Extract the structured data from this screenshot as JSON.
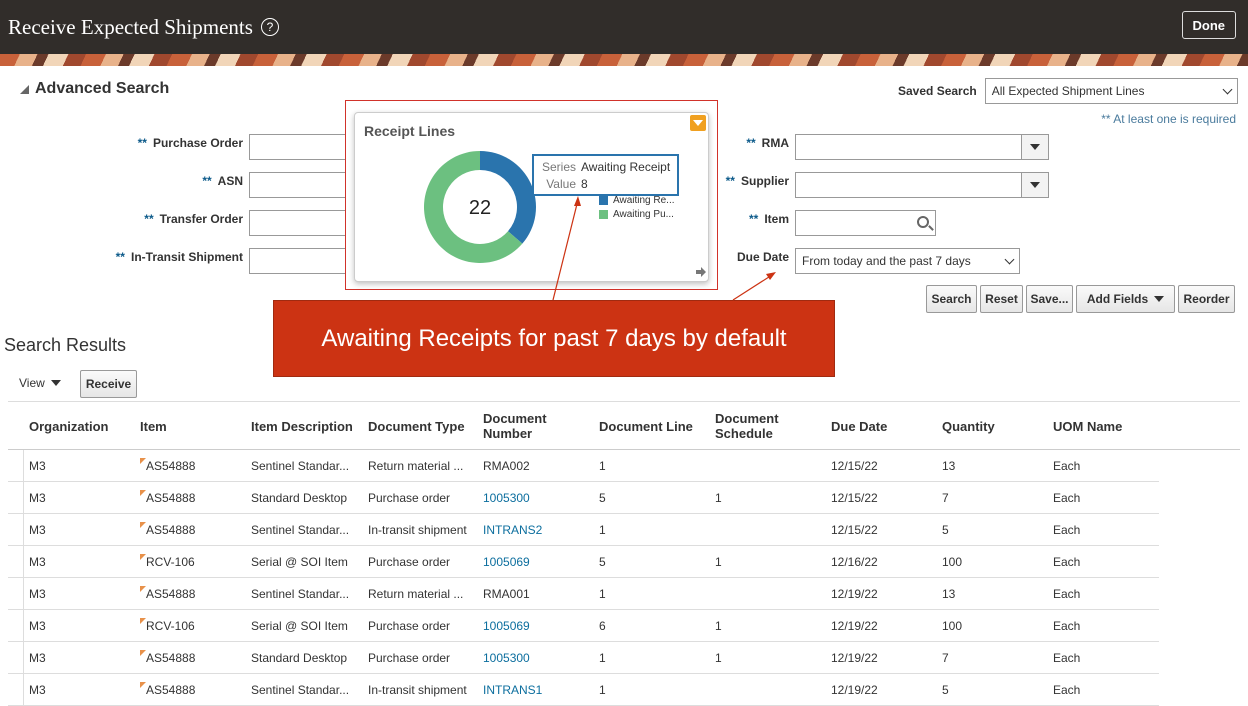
{
  "header": {
    "title": "Receive Expected Shipments",
    "help_glyph": "?",
    "done_label": "Done"
  },
  "search": {
    "advanced_label": "Advanced Search",
    "saved_search_label": "Saved Search",
    "saved_search_value": "All Expected Shipment Lines",
    "required_note": "** At least one is required",
    "required_marker": "**",
    "fields": {
      "purchase_order": "Purchase Order",
      "asn": "ASN",
      "transfer_order": "Transfer Order",
      "in_transit_shipment": "In-Transit Shipment",
      "rma": "RMA",
      "supplier": "Supplier",
      "item": "Item",
      "due_date": "Due Date"
    },
    "due_date_value": "From today and the past 7 days",
    "buttons": {
      "search": "Search",
      "reset": "Reset",
      "save": "Save...",
      "add_fields": "Add Fields",
      "reorder": "Reorder"
    }
  },
  "popup": {
    "title": "Receipt Lines",
    "total": "22",
    "legend": [
      "Awaiting Re...",
      "Awaiting Pu..."
    ],
    "tooltip": {
      "series_key": "Series",
      "series_value": "Awaiting Receipt",
      "value_key": "Value",
      "value_value": "8"
    },
    "colors": {
      "awaiting_receipt": "#2a74ad",
      "awaiting_putaway": "#6cc080"
    },
    "segments": [
      {
        "name": "Awaiting Receipt",
        "value": 8
      },
      {
        "name": "Awaiting Putaway",
        "value": 14
      }
    ]
  },
  "callout": {
    "text": "Awaiting Receipts for past 7 days by default"
  },
  "results": {
    "title": "Search Results",
    "view_label": "View",
    "receive_label": "Receive",
    "columns": [
      "Organization",
      "Item",
      "Item Description",
      "Document Type",
      "Document Number",
      "Document Line",
      "Document Schedule",
      "Due Date",
      "Quantity",
      "UOM Name"
    ],
    "rows": [
      [
        "M3",
        "AS54888",
        "Sentinel Standar...",
        "Return material ...",
        "RMA002",
        "1",
        "",
        "12/15/22",
        "13",
        "Each"
      ],
      [
        "M3",
        "AS54888",
        "Standard Desktop",
        "Purchase order",
        "1005300",
        "5",
        "1",
        "12/15/22",
        "7",
        "Each"
      ],
      [
        "M3",
        "AS54888",
        "Sentinel Standar...",
        "In-transit shipment",
        "INTRANS2",
        "1",
        "",
        "12/15/22",
        "5",
        "Each"
      ],
      [
        "M3",
        "RCV-106",
        "Serial @ SOI Item",
        "Purchase order",
        "1005069",
        "5",
        "1",
        "12/16/22",
        "100",
        "Each"
      ],
      [
        "M3",
        "AS54888",
        "Sentinel Standar...",
        "Return material ...",
        "RMA001",
        "1",
        "",
        "12/19/22",
        "13",
        "Each"
      ],
      [
        "M3",
        "RCV-106",
        "Serial @ SOI Item",
        "Purchase order",
        "1005069",
        "6",
        "1",
        "12/19/22",
        "100",
        "Each"
      ],
      [
        "M3",
        "AS54888",
        "Standard Desktop",
        "Purchase order",
        "1005300",
        "1",
        "1",
        "12/19/22",
        "7",
        "Each"
      ],
      [
        "M3",
        "AS54888",
        "Sentinel Standar...",
        "In-transit shipment",
        "INTRANS1",
        "1",
        "",
        "12/19/22",
        "5",
        "Each"
      ]
    ],
    "linked_doc_numbers": [
      "1005300",
      "INTRANS2",
      "1005069",
      "INTRANS1"
    ]
  }
}
